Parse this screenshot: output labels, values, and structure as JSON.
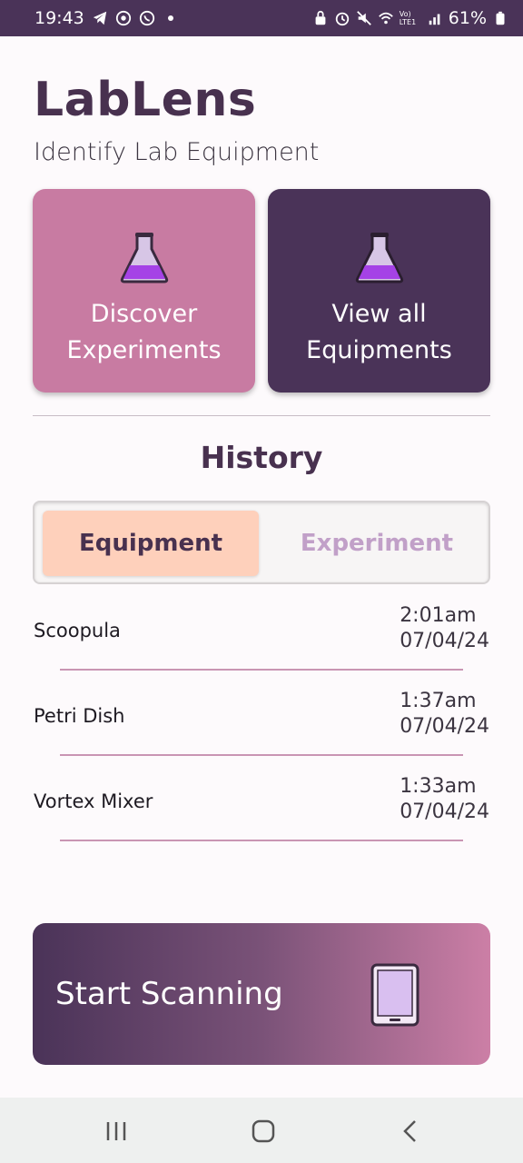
{
  "status_bar": {
    "time": "19:43",
    "battery": "61%",
    "network": "Vo) LTE1"
  },
  "header": {
    "title": "LabLens",
    "subtitle": "Identify Lab Equipment"
  },
  "cards": {
    "discover": {
      "line1": "Discover",
      "line2": "Experiments",
      "icon": "flask-icon"
    },
    "view_all": {
      "line1": "View all",
      "line2": "Equipments",
      "icon": "flask-icon"
    }
  },
  "history": {
    "heading": "History",
    "tabs": [
      {
        "label": "Equipment",
        "active": true
      },
      {
        "label": "Experiment",
        "active": false
      }
    ],
    "items": [
      {
        "name": "Scoopula",
        "time": "2:01am",
        "date": "07/04/24"
      },
      {
        "name": "Petri Dish",
        "time": "1:37am",
        "date": "07/04/24"
      },
      {
        "name": "Vortex Mixer",
        "time": "1:33am",
        "date": "07/04/24"
      }
    ]
  },
  "scan_button": {
    "label": "Start Scanning",
    "icon": "tablet-icon"
  },
  "colors": {
    "primary_dark": "#4a3358",
    "primary_pink": "#c87ba2",
    "tab_active": "#fed0bb",
    "tab_inactive_text": "#c1a0c8"
  }
}
